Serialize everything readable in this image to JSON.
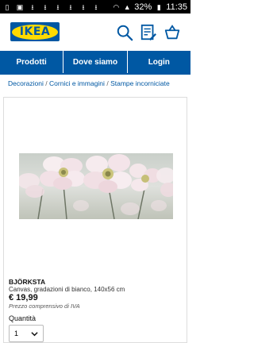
{
  "status_bar": {
    "battery": "32%",
    "time": "11:35"
  },
  "header": {
    "logo_text": "IKEA",
    "icons": [
      "search-icon",
      "shopping-list-icon",
      "cart-icon"
    ]
  },
  "nav": {
    "items": [
      {
        "label": "Prodotti"
      },
      {
        "label": "Dove siamo"
      },
      {
        "label": "Login"
      }
    ]
  },
  "breadcrumb": {
    "items": [
      "Decorazioni",
      "Cornici e immagini",
      "Stampe incorniciate"
    ],
    "separator": "/"
  },
  "product": {
    "name": "BJÖRKSTA",
    "description": "Canvas, gradazioni di bianco, 140x56 cm",
    "price": "€ 19,99",
    "vat_note": "Prezzo comprensivo di IVA",
    "quantity_label": "Quantità",
    "quantity_value": "1"
  },
  "colors": {
    "brand_blue": "#0058a3",
    "brand_yellow": "#ffdb00"
  }
}
